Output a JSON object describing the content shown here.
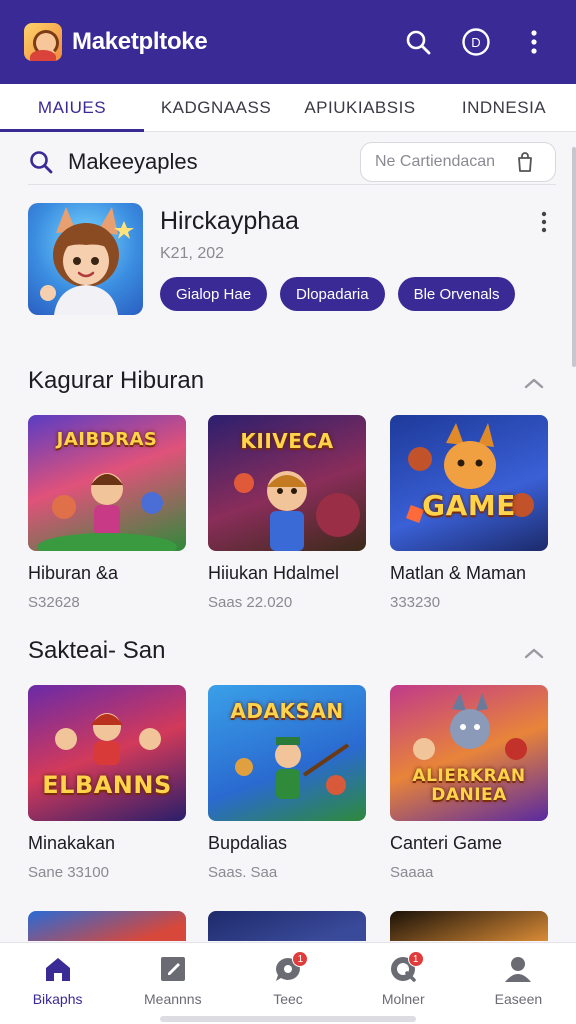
{
  "appbar": {
    "title": "Maketpltoke",
    "bg_color": "#3a2a96",
    "icons": [
      "app-logo-icon",
      "search-icon",
      "profile-d-icon",
      "more-vertical-icon"
    ],
    "profile_letter": "D"
  },
  "tabs": [
    {
      "label": "MAIUES",
      "active": true
    },
    {
      "label": "KADGNAASS",
      "active": false
    },
    {
      "label": "APIUKIABSIS",
      "active": false
    },
    {
      "label": "INDNESIA",
      "active": false
    }
  ],
  "search": {
    "label": "Makeeyaples",
    "placeholder": "Ne Cartiendacan",
    "icons": [
      "search-icon",
      "bag-icon"
    ]
  },
  "featured": {
    "title": "Hirckayphaa",
    "subtitle": "K21, 202",
    "chips": [
      "Gialop Hae",
      "Dlopadaria",
      "Ble Orvenals"
    ]
  },
  "sections": [
    {
      "title": "Kagurar Hiburan",
      "items": [
        {
          "name": "Hiburan &a",
          "meta": "S32628",
          "art_text": "JAIBDRAS"
        },
        {
          "name": "Hiiukan Hdalmel",
          "meta": "Saas 22.020",
          "art_text": "KIIVECA"
        },
        {
          "name": "Matlan & Maman",
          "meta": "333230",
          "art_text": "GAME"
        }
      ]
    },
    {
      "title": "Sakteai- San",
      "items": [
        {
          "name": "Minakakan",
          "meta": "Sane 33100",
          "art_text": "ELBANNS"
        },
        {
          "name": "Bupdalias",
          "meta": "Saas. Saa",
          "art_text": "ADAKSAN"
        },
        {
          "name": "Canteri Game",
          "meta": "Saaaa",
          "art_text": "ALIERKRAN DANIEA"
        }
      ]
    }
  ],
  "bottom_nav": [
    {
      "label": "Bikaphs",
      "icon": "home-icon",
      "active": true,
      "badge": ""
    },
    {
      "label": "Meannns",
      "icon": "edit-square-icon",
      "active": false,
      "badge": ""
    },
    {
      "label": "Teec",
      "icon": "chat-icon",
      "active": false,
      "badge": "1"
    },
    {
      "label": "Molner",
      "icon": "notification-icon",
      "active": false,
      "badge": "1"
    },
    {
      "label": "Easeen",
      "icon": "person-icon",
      "active": false,
      "badge": ""
    }
  ],
  "colors": {
    "accent": "#3a2a96",
    "badge": "#e03c3c",
    "background": "#f6f6f8"
  }
}
